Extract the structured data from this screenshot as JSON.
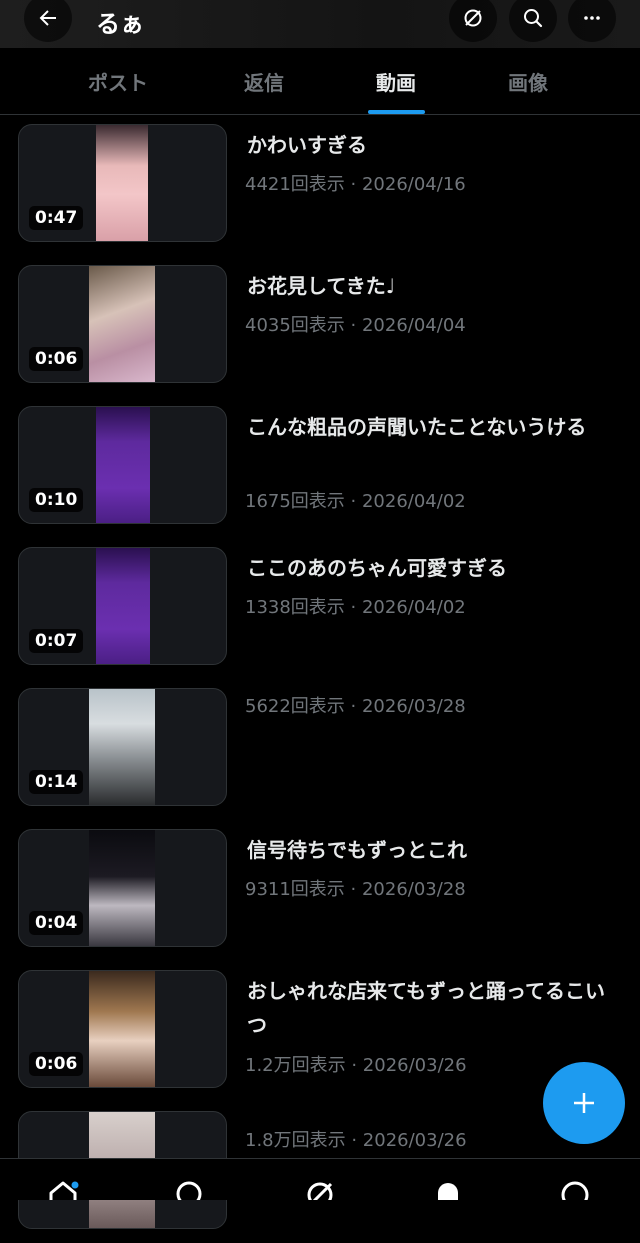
{
  "header": {
    "title": "るぁ",
    "back_icon": "arrow-left-icon",
    "actions": [
      "grok-icon",
      "search-icon",
      "more-icon"
    ]
  },
  "tabs": [
    {
      "label": "ポスト",
      "active": false
    },
    {
      "label": "返信",
      "active": false
    },
    {
      "label": "動画",
      "active": true
    },
    {
      "label": "画像",
      "active": false
    }
  ],
  "colors": {
    "accent": "#1d9bf0",
    "background": "#000000",
    "muted": "#71767b"
  },
  "videos": [
    {
      "duration": "0:47",
      "title": "かわいすぎる",
      "meta": "4421回表示 · 2026/04/16"
    },
    {
      "duration": "0:06",
      "title": "お花見してきた♩",
      "meta": "4035回表示 · 2026/04/04"
    },
    {
      "duration": "0:10",
      "title": "こんな粗品の声聞いたことないうける",
      "meta": "1675回表示 · 2026/04/02"
    },
    {
      "duration": "0:07",
      "title": "ここのあのちゃん可愛すぎる",
      "meta": "1338回表示 · 2026/04/02"
    },
    {
      "duration": "0:14",
      "title": "",
      "meta": "5622回表示 · 2026/03/28"
    },
    {
      "duration": "0:04",
      "title": "信号待ちでもずっとこれ",
      "meta": "9311回表示 · 2026/03/28"
    },
    {
      "duration": "0:06",
      "title": "おしゃれな店来てもずっと踊ってるこいつ",
      "meta": "1.2万回表示 · 2026/03/26"
    },
    {
      "duration": "",
      "title": "",
      "meta": "1.8万回表示 · 2026/03/26"
    }
  ],
  "fab": {
    "icon": "plus-icon"
  },
  "bottom_nav": [
    "home-icon",
    "search-icon",
    "grok-icon",
    "notifications-icon",
    "messages-icon"
  ]
}
